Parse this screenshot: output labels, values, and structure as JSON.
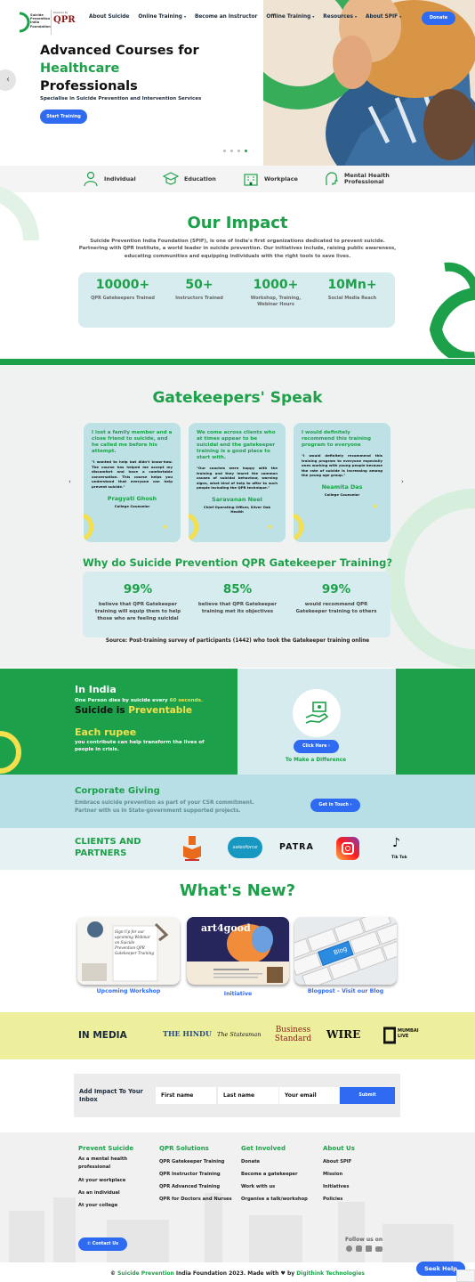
{
  "header": {
    "logo_lines": [
      "Suicide",
      "Prevention",
      "India",
      "Foundation"
    ],
    "logo_powered": "Powered By",
    "logo_qpr": "QPR",
    "nav": [
      "About Suicide",
      "Online Training",
      "Become an Instructor",
      "Offline Training",
      "Resources",
      "About SPIF"
    ],
    "nav_dropdown": [
      false,
      true,
      false,
      true,
      true,
      true
    ],
    "donate": "Donate"
  },
  "hero": {
    "title_line1": "Advanced Courses for",
    "title_line2": "Healthcare",
    "title_line3": "Professionals",
    "subtitle": "Specialise in Suicide Prevention and Intervention Services",
    "cta": "Start Training",
    "prev_arrow": "‹"
  },
  "categories": [
    "Individual",
    "Education",
    "Workplace",
    "Mental Health Professional"
  ],
  "impact": {
    "title": "Our Impact",
    "text": "Suicide Prevention India Foundation (SPIF), is one of India's first organizations dedicated to prevent suicide. Partnering with QPR Institute, a world leader in suicide prevention. Our initiatives include, raising public awareness, educating communities and equipping individuals with the right tools to save lives.",
    "stats": [
      {
        "value": "10000+",
        "label": "QPR Gatekeepers Trained"
      },
      {
        "value": "50+",
        "label": "Instructors Trained"
      },
      {
        "value": "1000+",
        "label": "Workshop, Training, Webinar Hours"
      },
      {
        "value": "10Mn+",
        "label": "Social Media Reach"
      }
    ]
  },
  "gatekeepers": {
    "title": "Gatekeepers' Speak",
    "cards": [
      {
        "quote_title": "I lost a family member and a close friend to suicide, and he called me before his attempt.",
        "text": "\"I wanted to help but didn't know-how. The course has helped me accept my discomfort and have a comfortable conversation. This course helps you understand that everyone can help prevent suicide.\"",
        "name": "Pragyati Ghosh",
        "role": "College Counselor"
      },
      {
        "quote_title": "We come across clients who at times appear to be suicidal and the gatekeeper training is a good place to start with.",
        "text": "\"Our coaches were happy with the training and they learnt the common causes of suicidal behaviour, warning signs, what kind of help to offer to such people including the QPR technique.\"",
        "name": "Saravanan Neel",
        "role": "Chief Operating Officer, Silver Oak Health"
      },
      {
        "quote_title": "I would definitely recommend this training program to everyone",
        "text": "\"I would definitely recommend this training program to everyone especially ones working with young people because the rate of suicide is increasing among the young age group.\"",
        "name": "Neamita Das",
        "role": "College Counselor"
      }
    ]
  },
  "why": {
    "title": "Why do Suicide Prevention QPR Gatekeeper Training?",
    "items": [
      {
        "value": "99%",
        "label": "believe that QPR Gatekeeper training will equip them to help those who are feeling suicidal"
      },
      {
        "value": "85%",
        "label": "believe that QPR Gatekeeper training met its objectives"
      },
      {
        "value": "99%",
        "label": "would recommend QPR Gatekeeper training to others"
      }
    ],
    "source": "Source: Post-training survey of participants (1442) who took the Gatekeeper training online"
  },
  "india": {
    "title": "In India",
    "line_prefix": "One Person dies by suicide every ",
    "line_highlight": "60 seconds.",
    "preventable_prefix": "Suicide is ",
    "preventable_highlight": "Preventable",
    "rupee_title": "Each rupee",
    "rupee_text": "you contribute can help transform the lives of people in crisis.",
    "click_here": "Click Here",
    "make_difference": "To Make a Difference"
  },
  "corporate": {
    "title": "Corporate Giving",
    "text": "Embrace suicide prevention as part of your CSR commitment. Partner with us in State-government supported projects.",
    "cta": "Get in Touch"
  },
  "clients": {
    "title": "CLIENTS AND PARTNERS",
    "logos": [
      "salesforce",
      "PATRA",
      "Tik Tok"
    ]
  },
  "whats_new": {
    "title": "What's New?",
    "items": [
      {
        "caption": "Upcoming Workshop",
        "art": "Sign Up for our upcoming Webinar on Suicide Prevention QPR Gatekeeper Training"
      },
      {
        "caption": "Initiative",
        "art": "art4good"
      },
      {
        "caption": "Blogpost – Visit our Blog",
        "art": "Blog"
      }
    ]
  },
  "media": {
    "title": "IN MEDIA",
    "logos": [
      "THE HINDU",
      "The Statesman",
      "Business Standard",
      "WIRE",
      "MUMBAI LIVE"
    ]
  },
  "subscribe": {
    "title": "Add Impact To Your Inbox",
    "first": "First name",
    "last": "Last name",
    "email": "Your email",
    "submit": "Submit"
  },
  "footer": {
    "cols": [
      {
        "title": "Prevent Suicide",
        "items": [
          "As a mental health professional",
          "At your workplace",
          "As an individual",
          "At your college"
        ]
      },
      {
        "title": "QPR Solutions",
        "items": [
          "QPR Gatekeeper Training",
          "QPR Instructor Training",
          "QPR Advanced Training",
          "QPR for Doctors and Nurses"
        ]
      },
      {
        "title": "Get Involved",
        "items": [
          "Donate",
          "Become a gatekeeper",
          "Work with us",
          "Organise a talk/workshop"
        ]
      },
      {
        "title": "About Us",
        "items": [
          "About SPIF",
          "Mission",
          "Initiatives",
          "Policies"
        ]
      }
    ],
    "contact": "Contact Us",
    "follow": "Follow us on",
    "copy_prefix": "© ",
    "copy_brand": "Suicide Prevention",
    "copy_mid": " India Foundation 2023. Made with ♥ by ",
    "copy_dev": "Digithink Technologies",
    "seek_help": "Seek Help"
  },
  "colors": {
    "green": "#1da04a",
    "blue": "#2f6bf2",
    "light_teal": "#d7ecee",
    "yellow": "#f4e04d"
  }
}
